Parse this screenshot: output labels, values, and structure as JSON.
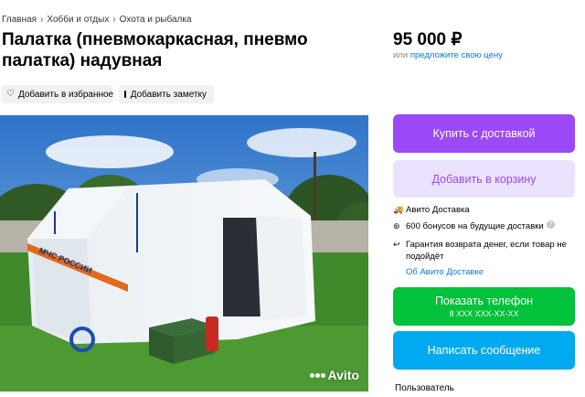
{
  "breadcrumbs": [
    "Главная",
    "Хобби и отдых",
    "Охота и рыбалка"
  ],
  "title": "Палатка (пневмокаркасная, пневмо палатка) надувная",
  "actions": {
    "favorite_label": "Добавить в избранное",
    "note_label": "Добавить заметку"
  },
  "photo": {
    "tent_text": "МЧС РОССИИ",
    "watermark": "Avito"
  },
  "price": {
    "value": "95 000 ₽",
    "alt_prefix": "или",
    "alt_link": "предложите свою цену"
  },
  "buttons": {
    "buy": "Купить с доставкой",
    "cart": "Добавить в корзину",
    "phone": "Показать телефон",
    "phone_sub": "8 XXX XXX-XX-XX",
    "message": "Написать сообщение"
  },
  "delivery_info": {
    "delivery": "Авито Доставка",
    "bonus": "600 бонусов на будущие доставки",
    "guarantee": "Гарантия возврата денег, если товар не подойдёт",
    "about_link": "Об Авито Доставке"
  },
  "seller_label": "Пользователь",
  "colors": {
    "buy": "#9c49f7",
    "cart_bg": "#ebe2ff",
    "phone": "#02c13a",
    "message": "#00a9f0",
    "link": "#0a7bd8"
  }
}
